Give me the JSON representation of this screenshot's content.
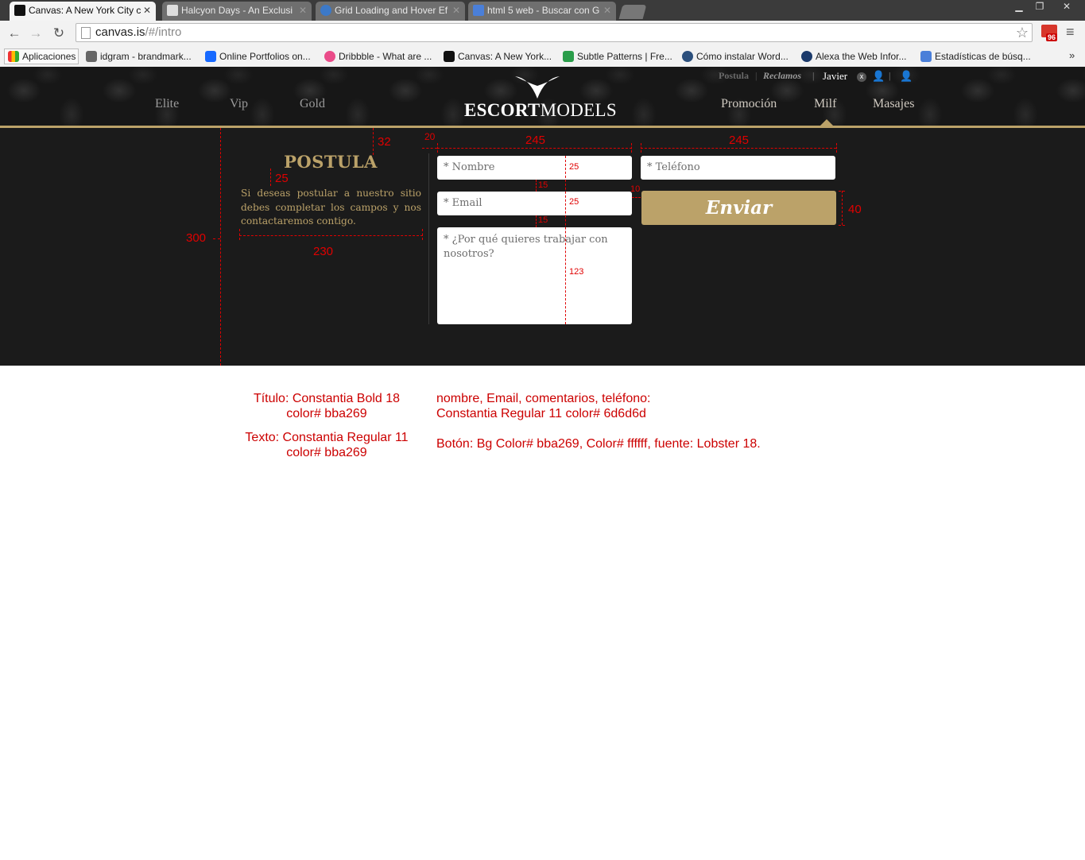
{
  "browser": {
    "tabs": [
      {
        "title": "Canvas: A New York City c",
        "active": true
      },
      {
        "title": "Halcyon Days - An Exclusi"
      },
      {
        "title": "Grid Loading and Hover Ef"
      },
      {
        "title": "html 5 web - Buscar con G"
      }
    ],
    "url_host": "canvas.is",
    "url_path": "/#/intro",
    "gmail_badge": "96",
    "bookmarks": [
      "Aplicaciones",
      "idgram - brandmark...",
      "Online Portfolios on...",
      "Dribbble - What are ...",
      "Canvas: A New York...",
      "Subtle Patterns | Fre...",
      "Cómo instalar Word...",
      "Alexa the Web Infor...",
      "Estadísticas de búsq..."
    ],
    "bookmarks_more": "»"
  },
  "site": {
    "nav_left": [
      "Elite",
      "Vip",
      "Gold"
    ],
    "nav_right": [
      "Promoción",
      "Milf",
      "Masajes"
    ],
    "logo_bold": "ESCORT",
    "logo_light": "MODELS",
    "util": {
      "postula": "Postula",
      "reclamos": "Reclamos",
      "user": "Javier",
      "close": "x"
    }
  },
  "form": {
    "title": "POSTULA",
    "text": "Si deseas postular a nuestro sitio debes completar los campos y nos contactaremos contigo.",
    "nombre_placeholder": "* Nombre",
    "email_placeholder": "* Email",
    "comment_placeholder": "* ¿Por qué quieres trabajar con nosotros?",
    "telefono_placeholder": "* Teléfono",
    "submit_label": "Enviar"
  },
  "annotations": {
    "m32": "32",
    "m20": "20",
    "m245a": "245",
    "m245b": "245",
    "m25a": "25",
    "m25b": "25",
    "m25c": "25",
    "m15a": "15",
    "m15b": "15",
    "m10": "10",
    "m40": "40",
    "m300": "300",
    "m230": "230",
    "m123": "123"
  },
  "specs": {
    "title_font": "Título: Constantia Bold 18",
    "title_color": "color# bba269",
    "text_font": "Texto: Constantia Regular 11",
    "text_color": "color# bba269",
    "fields_line1": "nombre, Email, comentarios, teléfono:",
    "fields_line2": "Constantia Regular 11 color# 6d6d6d",
    "button": "Botón: Bg Color# bba269, Color# ffffff, fuente: Lobster 18."
  },
  "colors": {
    "accent": "#bba269",
    "field_text": "#6d6d6d",
    "annotation": "#e00000"
  }
}
